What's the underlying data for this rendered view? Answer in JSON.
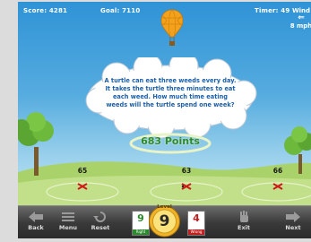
{
  "hud": {
    "score": "Score: 4281",
    "goal": "Goal: 7110",
    "timer": "Timer: 49",
    "wind_label": "Wind",
    "wind_speed": "8 mph"
  },
  "question": "A turtle can eat three weeds every day. It takes the turtle three minutes to eat each weed. How much time eating weeds will the turtle spend one week?",
  "points": "683 Points",
  "answers": [
    {
      "value": "65"
    },
    {
      "value": "63"
    },
    {
      "value": "66"
    }
  ],
  "toolbar": {
    "back": "Back",
    "menu": "Menu",
    "reset": "Reset",
    "right_count": "9",
    "right_label": "Right",
    "level_label": "Level",
    "level_number": "9",
    "wrong_count": "4",
    "wrong_label": "Wrong",
    "exit": "Exit",
    "next": "Next"
  },
  "colors": {
    "sky_top": "#2f93d6",
    "points_green": "#2e8a2e",
    "question_blue": "#1a5fa8",
    "mark_red": "#d01818",
    "right_card": "#2e8a2e",
    "wrong_card": "#c02020"
  }
}
